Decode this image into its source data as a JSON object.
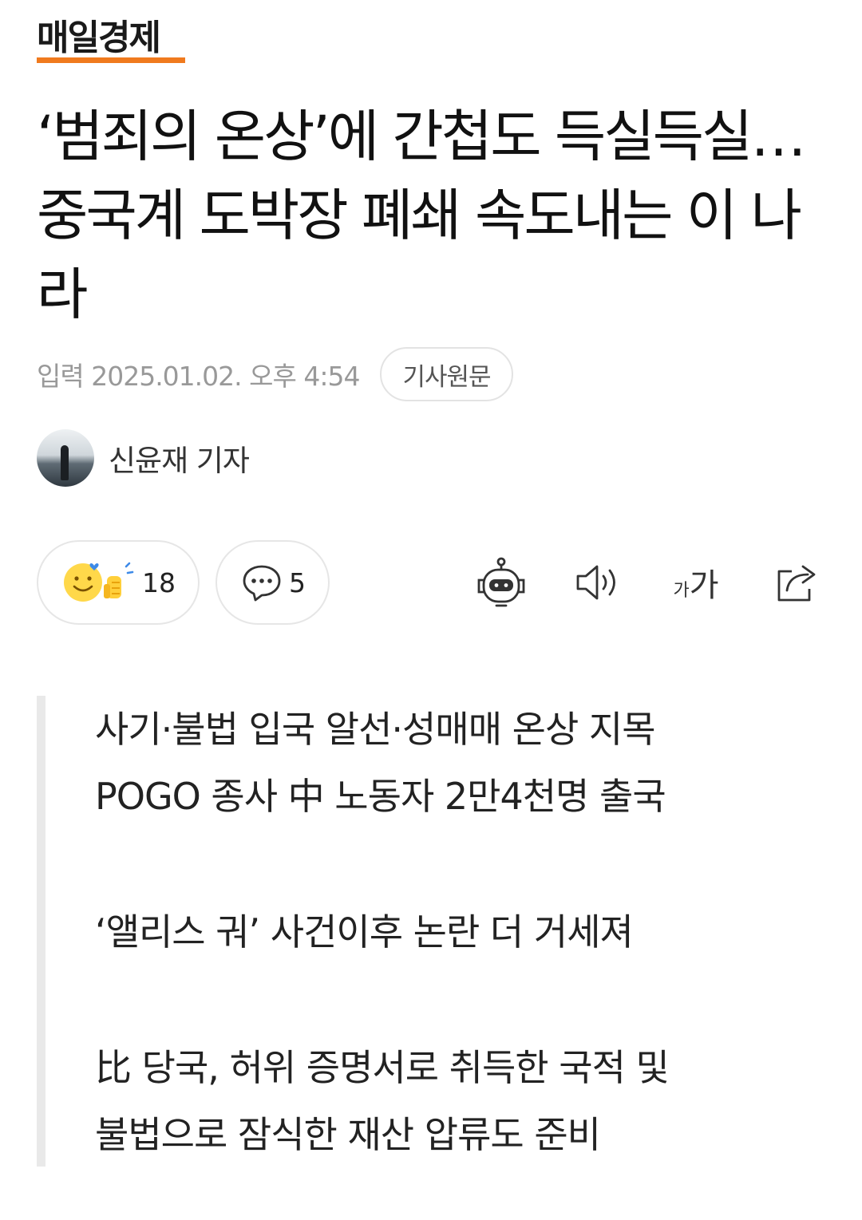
{
  "publisher": {
    "name": "매일경제"
  },
  "article": {
    "title": "‘범죄의 온상’에 간첩도 득실득실…중국계 도박장 폐쇄 속도내는 이 나라",
    "published": "입력 2025.01.02. 오후 4:54",
    "original_link_label": "기사원문",
    "author": "신윤재 기자"
  },
  "actions": {
    "reaction_count": "18",
    "comment_count": "5",
    "font_small": "가",
    "font_large": "가",
    "icons": [
      "smile-thumbs-reaction-icon",
      "comment-bubble-icon",
      "robot-summary-icon",
      "speaker-icon",
      "font-size-icon",
      "share-icon"
    ]
  },
  "summary": {
    "lines": [
      "사기·불법 입국 알선·성매매 온상 지목",
      "POGO 종사 中 노동자 2만4천명 출국",
      "‘앨리스 궈’ 사건이후 논란 더 거세져",
      "比 당국, 허위 증명서로 취득한 국적 및",
      "불법으로 잠식한 재산 압류도 준비"
    ]
  },
  "colors": {
    "logo_accent": "#f07a1e",
    "quote_bar": "#e9e9e9",
    "meta_gray": "#999999"
  }
}
